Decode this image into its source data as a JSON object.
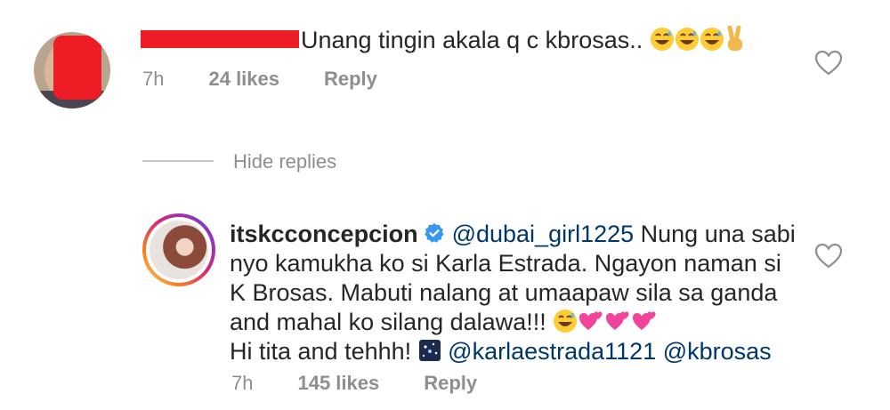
{
  "comment1": {
    "text": "Unang tingin akala q c kbrosas..",
    "time": "7h",
    "likes": "24 likes",
    "reply_label": "Reply"
  },
  "hide_replies": "Hide replies",
  "comment2": {
    "username": "itskcconcepcion",
    "mention1": "@dubai_girl1225",
    "text_part1": " Nung una sabi nyo kamukha ko si Karla Estrada. Ngayon naman si K Brosas. Mabuti nalang at umaapaw sila sa ganda and mahal ko silang dalawa!!! ",
    "text_part2": "Hi tita and tehhh! ",
    "mention2": "@karlaestrada1121",
    "mention3": "@kbrosas",
    "time": "7h",
    "likes": "145 likes",
    "reply_label": "Reply"
  },
  "colors": {
    "meta_gray": "#8e8e8e",
    "mention_blue": "#00376b",
    "verified_blue": "#3897f0",
    "redaction_red": "#ee1c25"
  }
}
